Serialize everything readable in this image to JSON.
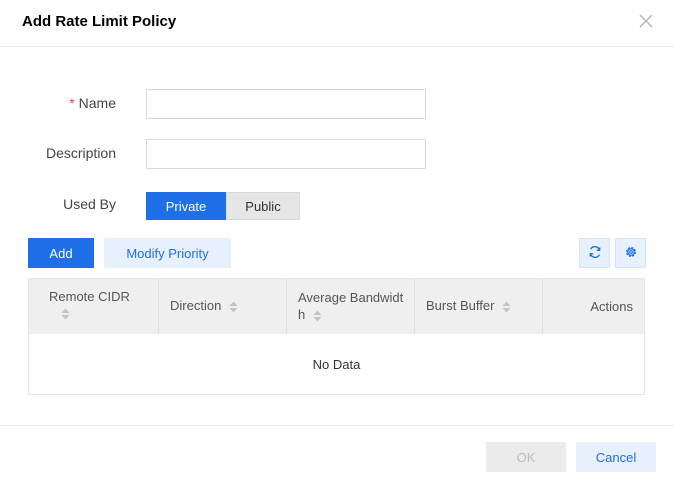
{
  "dialog": {
    "title": "Add Rate Limit Policy",
    "close_icon": "close-icon"
  },
  "form": {
    "name": {
      "label": "Name",
      "required_mark": "*",
      "value": "",
      "placeholder": ""
    },
    "description": {
      "label": "Description",
      "value": "",
      "placeholder": ""
    },
    "used_by": {
      "label": "Used By",
      "options": [
        "Private",
        "Public"
      ],
      "selected": "Private"
    }
  },
  "toolbar": {
    "add_label": "Add",
    "modify_priority_label": "Modify Priority",
    "refresh_icon": "refresh-icon",
    "settings_icon": "gear-icon"
  },
  "table": {
    "columns": [
      {
        "label": "Remote CIDR",
        "sortable": true
      },
      {
        "label": "Direction",
        "sortable": true
      },
      {
        "label": "Average Bandwidth",
        "sortable": true
      },
      {
        "label": "Burst Buffer",
        "sortable": true
      },
      {
        "label": "Actions",
        "sortable": false
      }
    ],
    "rows": [],
    "empty_text": "No Data"
  },
  "footer": {
    "ok_label": "OK",
    "cancel_label": "Cancel"
  },
  "colors": {
    "primary": "#1e6fe8",
    "primary_light": "#e7f0fd",
    "required": "#e54545"
  }
}
